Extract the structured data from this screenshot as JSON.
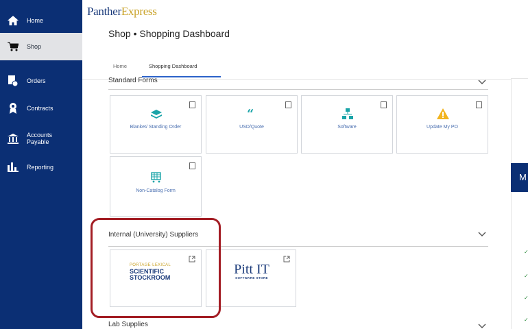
{
  "sidebar": {
    "items": [
      {
        "label": "Home",
        "icon": "home-icon",
        "active": false
      },
      {
        "label": "Shop",
        "icon": "cart-icon",
        "active": true
      },
      {
        "label": "Orders",
        "icon": "orders-icon",
        "active": false
      },
      {
        "label": "Contracts",
        "icon": "contracts-icon",
        "active": false
      },
      {
        "label": "Accounts",
        "label2": "Payable",
        "icon": "bank-icon",
        "active": false
      },
      {
        "label": "Reporting",
        "icon": "reporting-icon",
        "active": false
      }
    ]
  },
  "header": {
    "brand_part1": "Panther",
    "brand_part2": "Express",
    "title": "Shop • Shopping Dashboard"
  },
  "tabs": [
    {
      "label": "Home",
      "active": false
    },
    {
      "label": "Shopping Dashboard",
      "active": true
    }
  ],
  "sections": {
    "standard_forms": {
      "title": "Standard Forms",
      "tiles": [
        {
          "label": "Blanket/ Standing Order",
          "icon": "layers-icon"
        },
        {
          "label": "USD/Quote",
          "icon": "quote-icon"
        },
        {
          "label": "Software",
          "icon": "network-icon"
        },
        {
          "label": "Update My PO",
          "icon": "warning-icon"
        },
        {
          "label": "Non-Catalog Form",
          "icon": "cart-grid-icon"
        }
      ]
    },
    "internal_suppliers": {
      "title": "Internal (University) Suppliers",
      "tiles": [
        {
          "logo_line1": "PORTAGE·LEXICAL",
          "logo_line2": "SCIENTIFIC",
          "logo_line3": "STOCKROOM",
          "icon": "stockroom-logo"
        },
        {
          "logo_text": "Pitt IT",
          "logo_sub": "SOFTWARE STORE",
          "icon": "pitt-it-logo"
        }
      ]
    },
    "lab_supplies": {
      "title": "Lab Supplies"
    }
  },
  "right_panel": {
    "blue_label": "M"
  },
  "colors": {
    "sidebar": "#0b2f74",
    "accent": "#2b62c9",
    "highlight": "#a31d24",
    "brand_gold": "#c9a227"
  }
}
